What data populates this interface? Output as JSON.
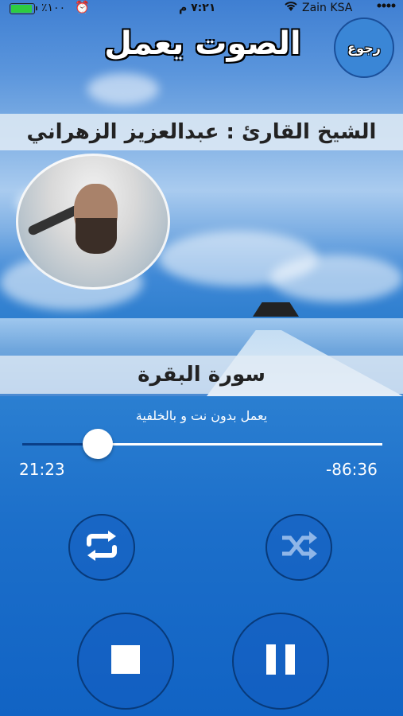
{
  "status_bar": {
    "battery_text": "٪١٠٠",
    "battery_level": 1.0,
    "time": "٧:٢١ م",
    "carrier": "Zain KSA"
  },
  "header": {
    "title": "الصوت يعمل",
    "back_label": "رجوع"
  },
  "reciter": {
    "label": "الشيخ القارئ : عبدالعزيز الزهراني"
  },
  "surah": {
    "name": "سورة البقرة"
  },
  "player": {
    "note": "يعمل بدون نت و بالخلفية",
    "elapsed": "21:23",
    "remaining": "-86:36",
    "progress": 0.2
  },
  "icons": {
    "repeat": "repeat-icon",
    "shuffle": "shuffle-icon",
    "stop": "stop-icon",
    "pause": "pause-icon",
    "alarm": "alarm-icon",
    "wifi": "wifi-icon",
    "battery": "battery-icon"
  },
  "colors": {
    "accent": "#1c6fca",
    "battery": "#2ecc40",
    "played_track": "#0a3f88"
  }
}
